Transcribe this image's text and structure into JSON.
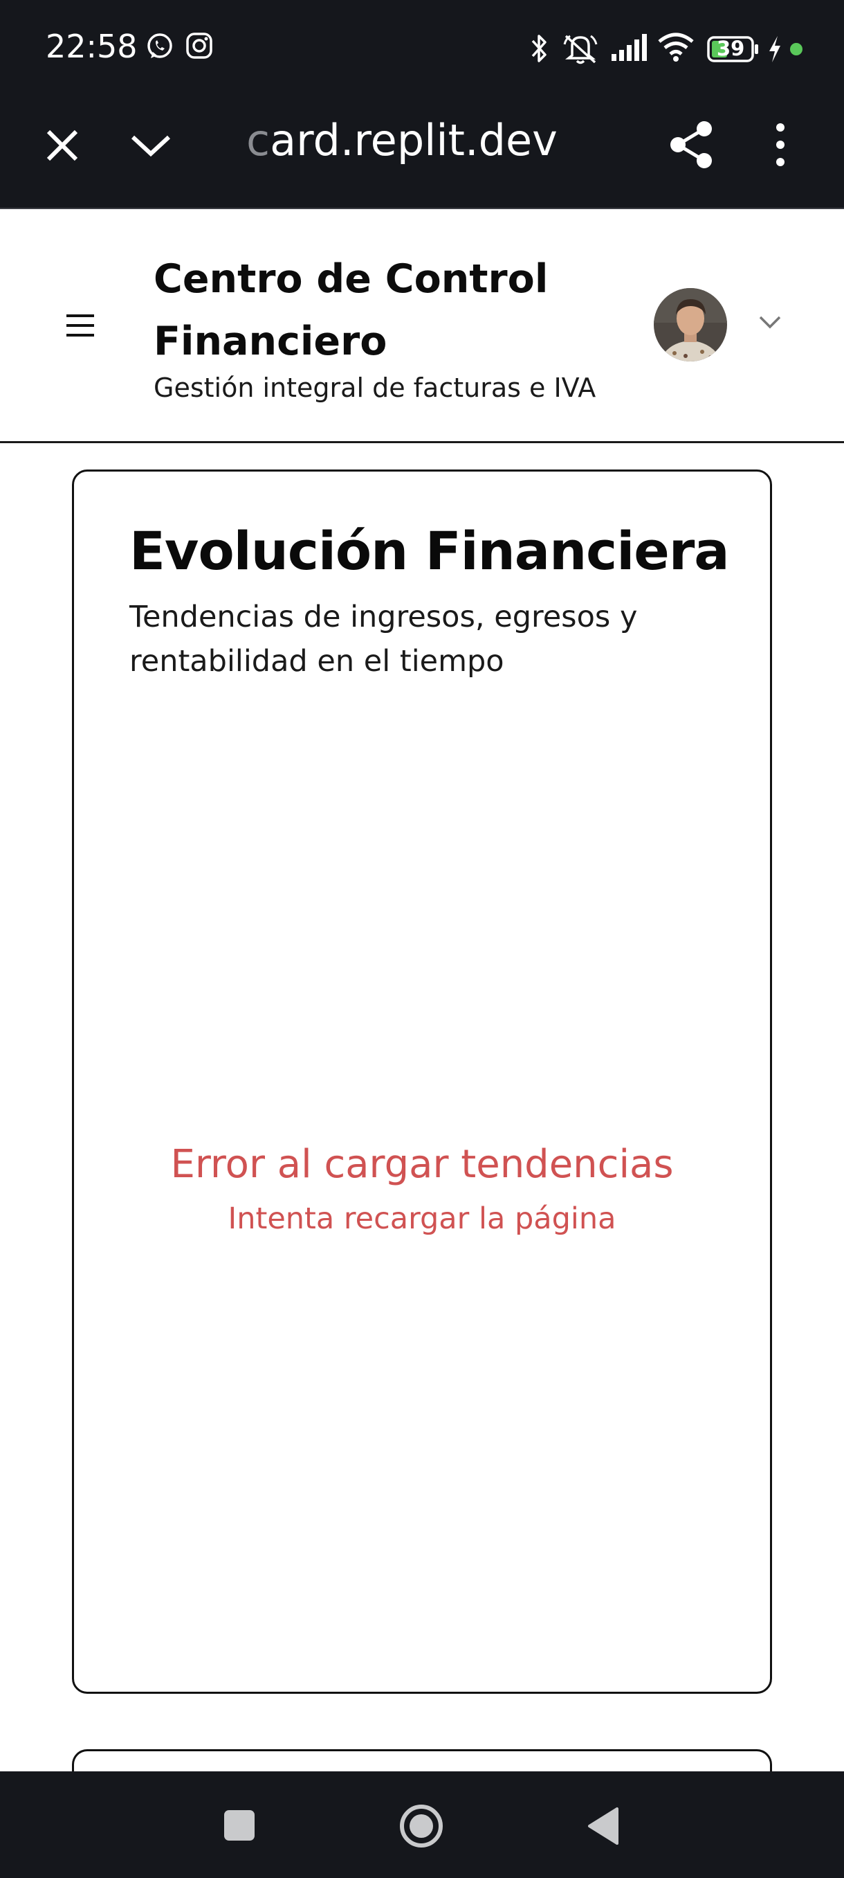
{
  "status_bar": {
    "time": "22:58",
    "battery_level": "39",
    "icons": [
      "whatsapp-icon",
      "instagram-icon",
      "bluetooth-icon",
      "mute-icon",
      "signal-icon",
      "wifi-icon",
      "battery-icon",
      "charging-icon",
      "notification-dot-icon"
    ]
  },
  "browser": {
    "url_leading": "c",
    "url_rest": "ard.replit.dev"
  },
  "header": {
    "title": "Centro de Control Financiero",
    "subtitle": "Gestión integral de facturas e IVA"
  },
  "card": {
    "title": "Evolución Financiera",
    "description": "Tendencias de ingresos, egresos y rentabilidad en el tiempo",
    "error_title": "Error al cargar tendencias",
    "error_hint": "Intenta recargar la página"
  },
  "colors": {
    "system_bar": "#15171c",
    "error": "#d05252",
    "text": "#0a0a0a",
    "battery_fill": "#5ac85a"
  }
}
